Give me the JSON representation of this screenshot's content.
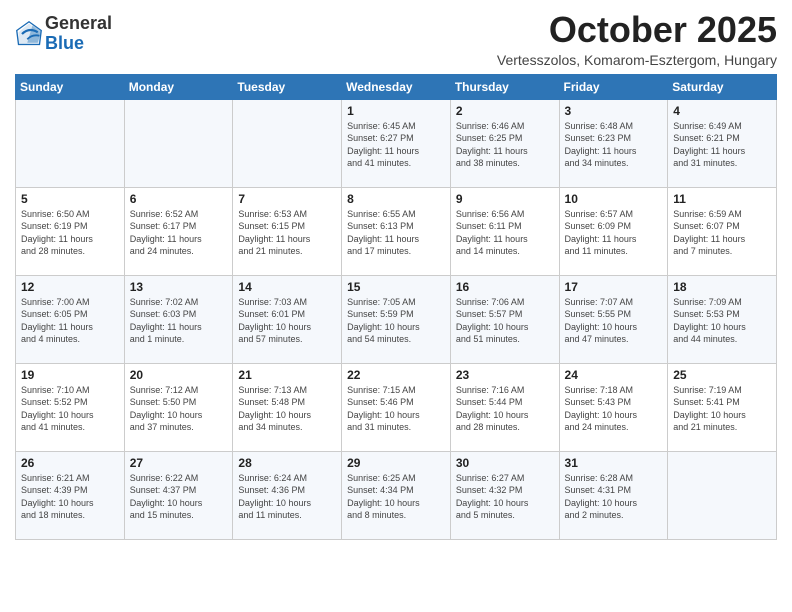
{
  "header": {
    "logo_general": "General",
    "logo_blue": "Blue",
    "month_title": "October 2025",
    "subtitle": "Vertesszolos, Komarom-Esztergom, Hungary"
  },
  "days_of_week": [
    "Sunday",
    "Monday",
    "Tuesday",
    "Wednesday",
    "Thursday",
    "Friday",
    "Saturday"
  ],
  "weeks": [
    [
      {
        "day": "",
        "info": ""
      },
      {
        "day": "",
        "info": ""
      },
      {
        "day": "",
        "info": ""
      },
      {
        "day": "1",
        "info": "Sunrise: 6:45 AM\nSunset: 6:27 PM\nDaylight: 11 hours\nand 41 minutes."
      },
      {
        "day": "2",
        "info": "Sunrise: 6:46 AM\nSunset: 6:25 PM\nDaylight: 11 hours\nand 38 minutes."
      },
      {
        "day": "3",
        "info": "Sunrise: 6:48 AM\nSunset: 6:23 PM\nDaylight: 11 hours\nand 34 minutes."
      },
      {
        "day": "4",
        "info": "Sunrise: 6:49 AM\nSunset: 6:21 PM\nDaylight: 11 hours\nand 31 minutes."
      }
    ],
    [
      {
        "day": "5",
        "info": "Sunrise: 6:50 AM\nSunset: 6:19 PM\nDaylight: 11 hours\nand 28 minutes."
      },
      {
        "day": "6",
        "info": "Sunrise: 6:52 AM\nSunset: 6:17 PM\nDaylight: 11 hours\nand 24 minutes."
      },
      {
        "day": "7",
        "info": "Sunrise: 6:53 AM\nSunset: 6:15 PM\nDaylight: 11 hours\nand 21 minutes."
      },
      {
        "day": "8",
        "info": "Sunrise: 6:55 AM\nSunset: 6:13 PM\nDaylight: 11 hours\nand 17 minutes."
      },
      {
        "day": "9",
        "info": "Sunrise: 6:56 AM\nSunset: 6:11 PM\nDaylight: 11 hours\nand 14 minutes."
      },
      {
        "day": "10",
        "info": "Sunrise: 6:57 AM\nSunset: 6:09 PM\nDaylight: 11 hours\nand 11 minutes."
      },
      {
        "day": "11",
        "info": "Sunrise: 6:59 AM\nSunset: 6:07 PM\nDaylight: 11 hours\nand 7 minutes."
      }
    ],
    [
      {
        "day": "12",
        "info": "Sunrise: 7:00 AM\nSunset: 6:05 PM\nDaylight: 11 hours\nand 4 minutes."
      },
      {
        "day": "13",
        "info": "Sunrise: 7:02 AM\nSunset: 6:03 PM\nDaylight: 11 hours\nand 1 minute."
      },
      {
        "day": "14",
        "info": "Sunrise: 7:03 AM\nSunset: 6:01 PM\nDaylight: 10 hours\nand 57 minutes."
      },
      {
        "day": "15",
        "info": "Sunrise: 7:05 AM\nSunset: 5:59 PM\nDaylight: 10 hours\nand 54 minutes."
      },
      {
        "day": "16",
        "info": "Sunrise: 7:06 AM\nSunset: 5:57 PM\nDaylight: 10 hours\nand 51 minutes."
      },
      {
        "day": "17",
        "info": "Sunrise: 7:07 AM\nSunset: 5:55 PM\nDaylight: 10 hours\nand 47 minutes."
      },
      {
        "day": "18",
        "info": "Sunrise: 7:09 AM\nSunset: 5:53 PM\nDaylight: 10 hours\nand 44 minutes."
      }
    ],
    [
      {
        "day": "19",
        "info": "Sunrise: 7:10 AM\nSunset: 5:52 PM\nDaylight: 10 hours\nand 41 minutes."
      },
      {
        "day": "20",
        "info": "Sunrise: 7:12 AM\nSunset: 5:50 PM\nDaylight: 10 hours\nand 37 minutes."
      },
      {
        "day": "21",
        "info": "Sunrise: 7:13 AM\nSunset: 5:48 PM\nDaylight: 10 hours\nand 34 minutes."
      },
      {
        "day": "22",
        "info": "Sunrise: 7:15 AM\nSunset: 5:46 PM\nDaylight: 10 hours\nand 31 minutes."
      },
      {
        "day": "23",
        "info": "Sunrise: 7:16 AM\nSunset: 5:44 PM\nDaylight: 10 hours\nand 28 minutes."
      },
      {
        "day": "24",
        "info": "Sunrise: 7:18 AM\nSunset: 5:43 PM\nDaylight: 10 hours\nand 24 minutes."
      },
      {
        "day": "25",
        "info": "Sunrise: 7:19 AM\nSunset: 5:41 PM\nDaylight: 10 hours\nand 21 minutes."
      }
    ],
    [
      {
        "day": "26",
        "info": "Sunrise: 6:21 AM\nSunset: 4:39 PM\nDaylight: 10 hours\nand 18 minutes."
      },
      {
        "day": "27",
        "info": "Sunrise: 6:22 AM\nSunset: 4:37 PM\nDaylight: 10 hours\nand 15 minutes."
      },
      {
        "day": "28",
        "info": "Sunrise: 6:24 AM\nSunset: 4:36 PM\nDaylight: 10 hours\nand 11 minutes."
      },
      {
        "day": "29",
        "info": "Sunrise: 6:25 AM\nSunset: 4:34 PM\nDaylight: 10 hours\nand 8 minutes."
      },
      {
        "day": "30",
        "info": "Sunrise: 6:27 AM\nSunset: 4:32 PM\nDaylight: 10 hours\nand 5 minutes."
      },
      {
        "day": "31",
        "info": "Sunrise: 6:28 AM\nSunset: 4:31 PM\nDaylight: 10 hours\nand 2 minutes."
      },
      {
        "day": "",
        "info": ""
      }
    ]
  ]
}
